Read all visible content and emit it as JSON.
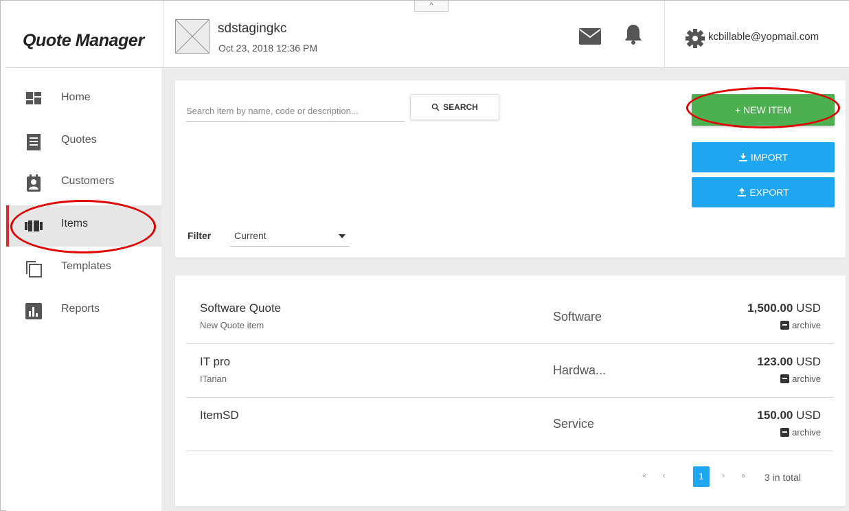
{
  "app": {
    "title": "Quote Manager"
  },
  "header": {
    "account_name": "sdstagingkc",
    "account_date": "Oct 23, 2018 12:36 PM",
    "collapse_glyph": "^",
    "icons": [
      "mail-icon",
      "bell-icon",
      "gear-icon"
    ],
    "user_email": "kcbillable@yopmail.com"
  },
  "sidebar": {
    "items": [
      {
        "label": "Home",
        "icon": "home-grid-icon",
        "active": false
      },
      {
        "label": "Quotes",
        "icon": "quotes-list-icon",
        "active": false
      },
      {
        "label": "Customers",
        "icon": "customers-contact-icon",
        "active": false
      },
      {
        "label": "Items",
        "icon": "items-icon",
        "active": true
      },
      {
        "label": "Templates",
        "icon": "templates-copy-icon",
        "active": false
      },
      {
        "label": "Reports",
        "icon": "reports-chart-icon",
        "active": false
      }
    ],
    "active_color": "#d32f2f"
  },
  "toolbar": {
    "search_placeholder": "Search item by name, code or description...",
    "search_label": "SEARCH",
    "new_item_label": "+ NEW ITEM",
    "import_label": "IMPORT",
    "export_label": "EXPORT",
    "filter_label": "Filter",
    "filter_value": "Current"
  },
  "colors": {
    "new_item_button": "#4caf50",
    "import_export_button": "#1ea7f0",
    "annotation": "#e00000"
  },
  "items": [
    {
      "name": "Software Quote",
      "description": "New Quote item",
      "category": "Software",
      "price_amount": "1,500.00",
      "price_currency": "USD",
      "action": "archive"
    },
    {
      "name": "IT pro",
      "description": "ITarian",
      "category": "Hardwa...",
      "price_amount": "123.00",
      "price_currency": "USD",
      "action": "archive"
    },
    {
      "name": "ItemSD",
      "description": "",
      "category": "Service",
      "price_amount": "150.00",
      "price_currency": "USD",
      "action": "archive"
    }
  ],
  "pagination": {
    "first": "«",
    "prev": "‹",
    "current": "1",
    "next": "›",
    "last": "»",
    "total_text": "3 in total"
  }
}
